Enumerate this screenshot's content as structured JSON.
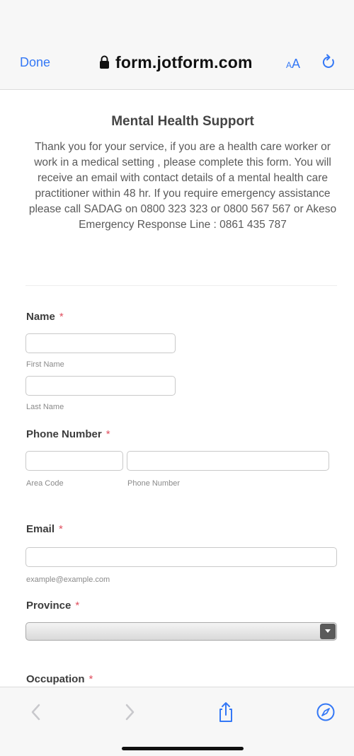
{
  "browser": {
    "done_label": "Done",
    "url": "form.jotform.com",
    "text_size_label_small": "A",
    "text_size_label_large": "A",
    "accent_color": "#3478f6"
  },
  "form": {
    "title": "Mental Health Support",
    "description": "Thank you for your service, if you are a health care worker or work in a medical setting , please complete this form. You will receive an email with contact details of a mental health care practitioner within 48 hr. If you require emergency assistance please call SADAG on 0800 323 323 or 0800 567 567 or Akeso Emergency Response Line : 0861 435 787",
    "required_marker": "*",
    "fields": {
      "name": {
        "label": "Name",
        "first_sublabel": "First Name",
        "first_value": "",
        "last_sublabel": "Last Name",
        "last_value": ""
      },
      "phone": {
        "label": "Phone Number",
        "area_sublabel": "Area Code",
        "area_value": "",
        "number_sublabel": "Phone Number",
        "number_value": ""
      },
      "email": {
        "label": "Email",
        "sublabel": "example@example.com",
        "value": ""
      },
      "province": {
        "label": "Province",
        "selected": ""
      },
      "occupation": {
        "label": "Occupation"
      }
    }
  },
  "toolbar": {
    "icons": [
      "back-icon",
      "forward-icon",
      "share-icon",
      "compass-icon"
    ]
  }
}
